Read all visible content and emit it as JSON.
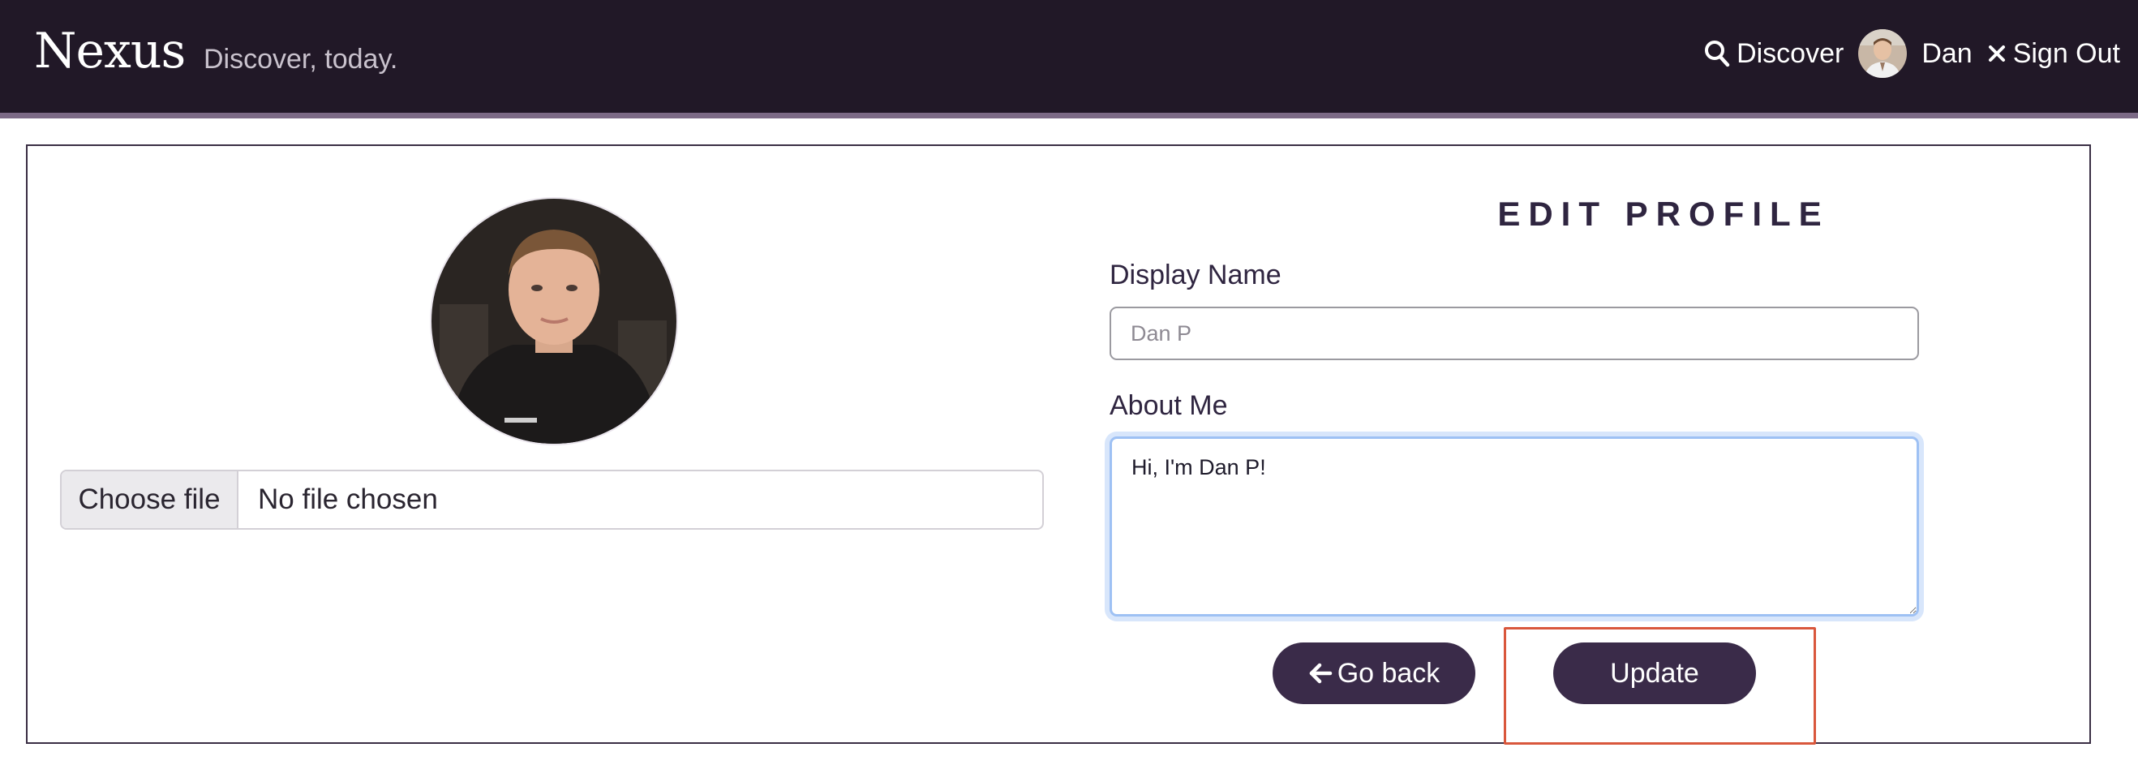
{
  "navbar": {
    "brand": "Nexus",
    "tagline": "Discover, today.",
    "discover_label": "Discover",
    "user_name": "Dan",
    "signout_label": "Sign Out"
  },
  "profile": {
    "choose_file_label": "Choose file",
    "file_status": "No file chosen"
  },
  "form": {
    "heading": "EDIT PROFILE",
    "display_name_label": "Display Name",
    "display_name_placeholder": "Dan P",
    "about_label": "About Me",
    "about_value": "Hi, I'm Dan P!",
    "back_label": "Go back",
    "update_label": "Update"
  },
  "colors": {
    "navbar_bg": "#211827",
    "accent": "#3a2b49",
    "highlight": "#d9573c",
    "focus_ring": "#9ec1f4"
  },
  "icons": {
    "discover": "search-icon",
    "signout": "close-icon",
    "back": "arrow-left-icon"
  }
}
